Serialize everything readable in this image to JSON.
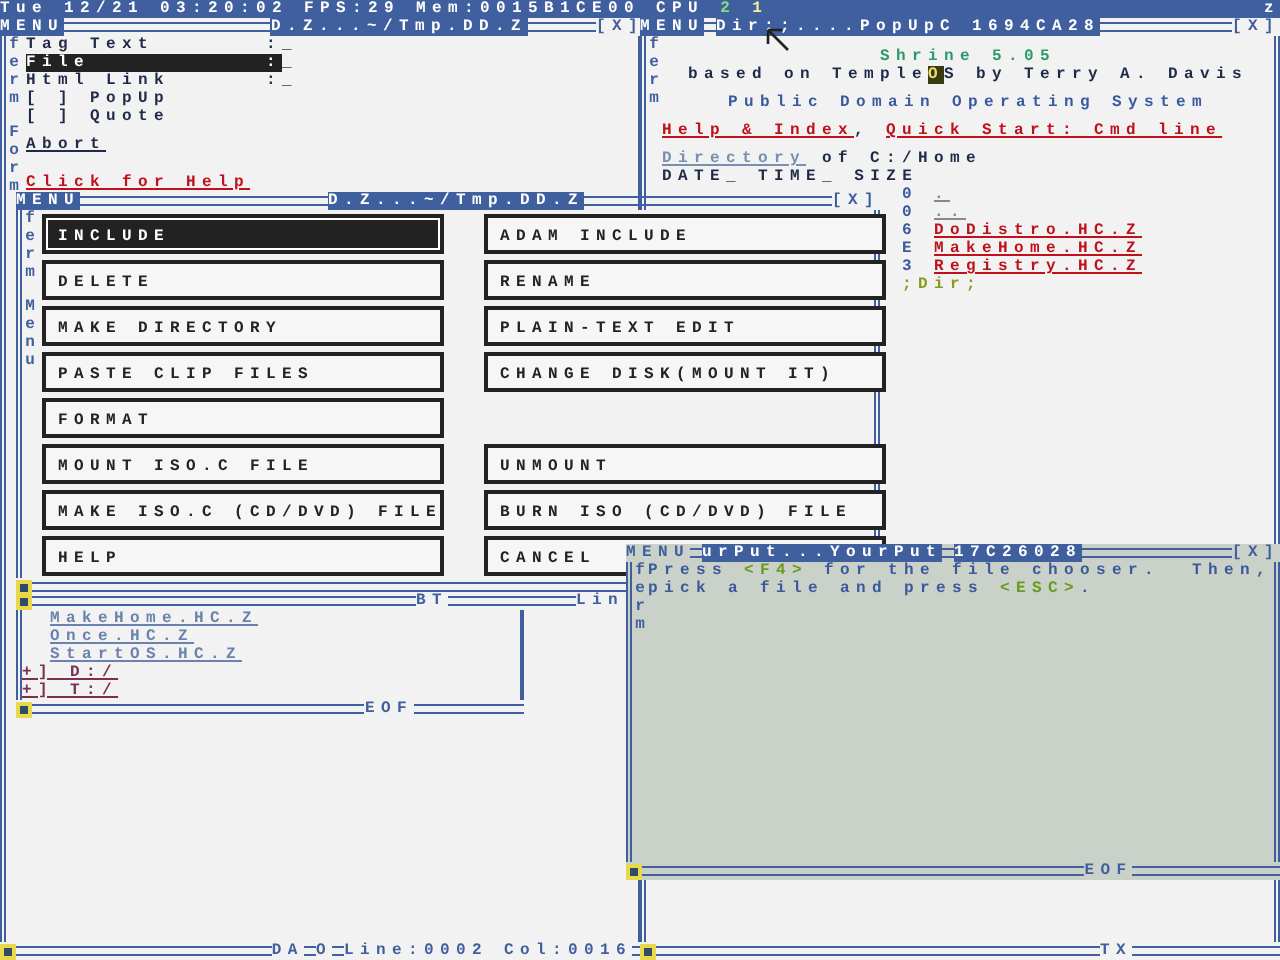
{
  "top_bar": {
    "clock": "Tue 12/21 03:20:02",
    "fps": "FPS:29",
    "mem": "Mem:0015B1CE00",
    "cpu_label": "CPU",
    "cpus": [
      "2",
      "1"
    ],
    "edge": "z"
  },
  "form_window": {
    "menu": "MENU",
    "title": "D.Z...~/Tmp.DD.Z",
    "close": "[X]",
    "border_labels": [
      "ferm",
      "Form"
    ],
    "fields": [
      {
        "label": "Tag Text",
        "sep": ":",
        "value": "_",
        "selected": false
      },
      {
        "label": "File",
        "sep": ":",
        "value": "_",
        "selected": true
      },
      {
        "label": "Html Link",
        "sep": ":",
        "value": "_",
        "selected": false
      }
    ],
    "checkboxes": [
      {
        "box": "[ ]",
        "label": "PopUp",
        "checked": false
      },
      {
        "box": "[ ]",
        "label": "Quote",
        "checked": false
      }
    ],
    "abort": "Abort",
    "help_link": "Click for Help",
    "status": {
      "mode": "DA",
      "flag": "O",
      "line": "Line:0002",
      "col": "Col:0016"
    }
  },
  "dir_window": {
    "menu": "MENU",
    "title": "Dir;;....PopUpC",
    "address": "1694CA28",
    "close": "[X]",
    "border_label": "ferm",
    "os_name": "Shrine 5.05",
    "credit": {
      "before": "based on Temple",
      "cursor": "O",
      "after": "S by Terry A. Davis"
    },
    "tagline": "Public Domain Operating System",
    "links": [
      "Help & Index",
      "Quick Start: Cmd line"
    ],
    "link_separator": ",",
    "directory_link": "Directory",
    "directory_rest": "of C:/Home",
    "columns": [
      "DATE_",
      "TIME_",
      "SIZE"
    ],
    "entries": [
      {
        "size": "0",
        "name": ".",
        "kind": "dir"
      },
      {
        "size": "0",
        "name": "..",
        "kind": "dir"
      },
      {
        "size": "6",
        "name": "DoDistro.HC.Z",
        "kind": "file"
      },
      {
        "size": "E",
        "name": "MakeHome.HC.Z",
        "kind": "file"
      },
      {
        "size": "3",
        "name": "Registry.HC.Z",
        "kind": "file"
      }
    ],
    "command": ";Dir;",
    "bottom_label": "TX"
  },
  "files_window": {
    "top_labels": [
      "BT",
      "Lin"
    ],
    "files": [
      "MakeHome.HC.Z",
      "Once.HC.Z",
      "StartOS.HC.Z"
    ],
    "drives": [
      {
        "box": "+]",
        "name": "D:/"
      },
      {
        "box": "+]",
        "name": "T:/"
      }
    ],
    "eof": "EOF"
  },
  "menu_dialog": {
    "menu": "MENU",
    "title": "D.Z...~/Tmp.DD.Z",
    "close": "[X]",
    "border_labels": [
      "ferm",
      "Menu"
    ],
    "rows": [
      [
        {
          "label": "INCLUDE",
          "selected": true
        },
        {
          "label": "ADAM INCLUDE",
          "selected": false
        }
      ],
      [
        {
          "label": "DELETE",
          "selected": false
        },
        {
          "label": "RENAME",
          "selected": false
        }
      ],
      [
        {
          "label": "MAKE DIRECTORY",
          "selected": false
        },
        {
          "label": "PLAIN-TEXT EDIT",
          "selected": false
        }
      ],
      [
        {
          "label": "PASTE CLIP FILES",
          "selected": false
        },
        {
          "label": "CHANGE DISK(MOUNT IT)",
          "selected": false
        }
      ],
      [
        {
          "label": "FORMAT",
          "selected": false
        }
      ],
      [
        {
          "label": "MOUNT ISO.C FILE",
          "selected": false
        },
        {
          "label": "UNMOUNT",
          "selected": false
        }
      ],
      [
        {
          "label": "MAKE ISO.C (CD/DVD) FILE",
          "selected": false
        },
        {
          "label": "BURN ISO (CD/DVD) FILE",
          "selected": false
        }
      ],
      [
        {
          "label": "HELP",
          "selected": false
        },
        {
          "label": "CANCEL",
          "selected": false
        }
      ]
    ]
  },
  "input_window": {
    "menu": "MENU",
    "title": "urPut...YourPut",
    "address": "17C26028",
    "close": "[X]",
    "border_label": "ferm",
    "lines": [
      [
        {
          "kind": "text",
          "text": "Press "
        },
        {
          "kind": "key",
          "text": "<F4>"
        },
        {
          "kind": "text",
          "text": " for the file chooser.  Then,"
        }
      ],
      [
        {
          "kind": "text",
          "text": "pick a file and press "
        },
        {
          "kind": "key",
          "text": "<ESC>"
        },
        {
          "kind": "text",
          "text": "."
        }
      ]
    ],
    "eof": "EOF"
  }
}
